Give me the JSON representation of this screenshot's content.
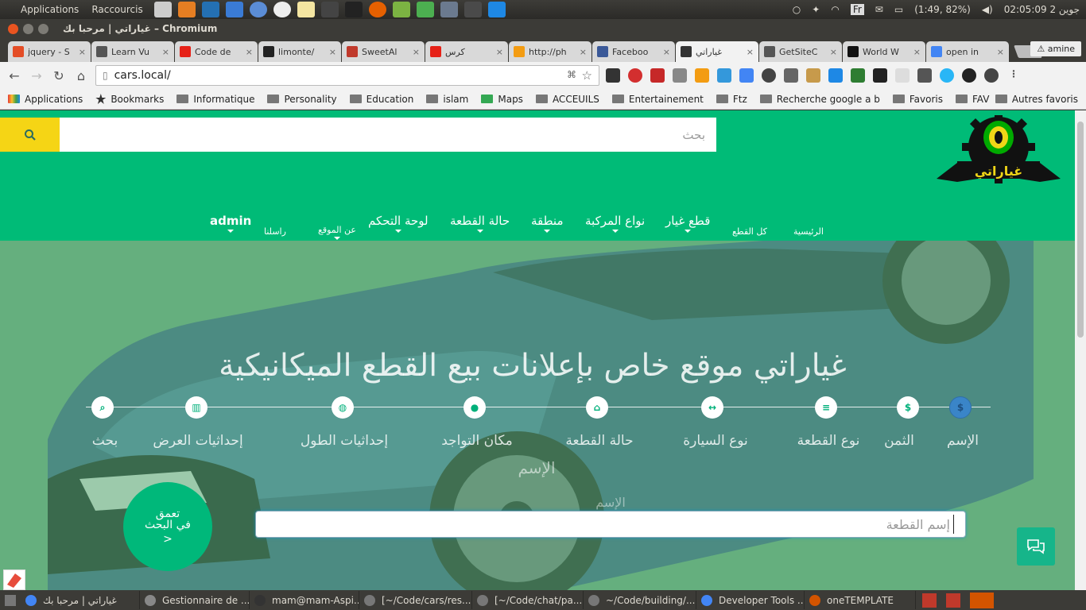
{
  "panel": {
    "applications": "Applications",
    "shortcuts": "Raccourcis",
    "keyboard": "Fr",
    "battery": "(1:49, 82%)",
    "clock": "02:05:09 2 جوين"
  },
  "window": {
    "title": "غياراتي | مرحبا بك – Chromium"
  },
  "tabs": [
    {
      "label": "jquery - S",
      "color": "#e44d26"
    },
    {
      "label": "Learn Vu",
      "color": "#555"
    },
    {
      "label": "Code de",
      "color": "#e62117"
    },
    {
      "label": "limonte/",
      "color": "#222"
    },
    {
      "label": "SweetAl",
      "color": "#c0392b"
    },
    {
      "label": "كرس",
      "color": "#e62117"
    },
    {
      "label": "http://ph",
      "color": "#f39c12"
    },
    {
      "label": "Faceboo",
      "color": "#3b5998"
    },
    {
      "label": "غياراتي",
      "color": "#333"
    },
    {
      "label": "GetSiteC",
      "color": "#555"
    },
    {
      "label": "World W",
      "color": "#111"
    },
    {
      "label": "open in",
      "color": "#4285f4"
    }
  ],
  "user": "amine",
  "omnibox": {
    "url": "cars.local/"
  },
  "bookmarks": [
    {
      "label": "Applications"
    },
    {
      "label": "Bookmarks"
    },
    {
      "label": "Informatique"
    },
    {
      "label": "Personality"
    },
    {
      "label": "Education"
    },
    {
      "label": "islam"
    },
    {
      "label": "Maps"
    },
    {
      "label": "ACCEUILS"
    },
    {
      "label": "Entertainement"
    },
    {
      "label": "Ftz"
    },
    {
      "label": "Recherche google a b"
    },
    {
      "label": "Favoris"
    },
    {
      "label": "FAV"
    }
  ],
  "bookmarks_other": "Autres favoris",
  "site": {
    "search_placeholder": "بحث",
    "logo_text": "غياراتي",
    "nav": {
      "home": "الرئيسية",
      "all_parts": "كل القطع",
      "spare_parts": "قطع غيار",
      "vehicle_types": "نواع المركبة",
      "region": "منطقة",
      "part_state": "حالة القطعة",
      "dashboard": "لوحة التحكم",
      "about": "عن الموقع",
      "contact": "راسلنا",
      "admin": "admin"
    },
    "hero_title": "غياراتي موقع خاص بإعلانات بيع القطع الميكانيكية",
    "steps": [
      {
        "label": "الإسم",
        "icon": "dollar-icon"
      },
      {
        "label": "الثمن",
        "icon": "dollar-icon"
      },
      {
        "label": "نوع القطعة",
        "icon": "list-icon"
      },
      {
        "label": "نوع السيارة",
        "icon": "arrows-icon"
      },
      {
        "label": "حالة القطعة",
        "icon": "home-icon"
      },
      {
        "label": "مكان التواجد",
        "icon": "map-pin-icon"
      },
      {
        "label": "إحداثيات الطول",
        "icon": "globe-icon"
      },
      {
        "label": "إحداثيات العرض",
        "icon": "map-icon"
      },
      {
        "label": "بحث",
        "icon": "search-icon"
      }
    ],
    "ghost_label_1": "الإسم",
    "ghost_label_2": "الإسم",
    "part_name_placeholder": "إسم القطعة",
    "deep_search": {
      "line1": "تعمق",
      "line2": "في البحث",
      "arrow": ">"
    }
  },
  "taskbar": [
    {
      "label": "غياراتي | مرحبا بك",
      "color": "#4285f4"
    },
    {
      "label": "Gestionnaire de ...",
      "color": "#888"
    },
    {
      "label": "mam@mam-Aspi...",
      "color": "#333"
    },
    {
      "label": "[~/Code/cars/res...",
      "color": "#777"
    },
    {
      "label": "[~/Code/chat/pa...",
      "color": "#777"
    },
    {
      "label": "~/Code/building/...",
      "color": "#777"
    },
    {
      "label": "Developer Tools ...",
      "color": "#4285f4"
    },
    {
      "label": "oneTEMPLATE",
      "color": "#d35400"
    }
  ],
  "colors": {
    "brand_green": "#00bb77",
    "search_yellow": "#f5d515",
    "active_step": "#3a85c8"
  }
}
